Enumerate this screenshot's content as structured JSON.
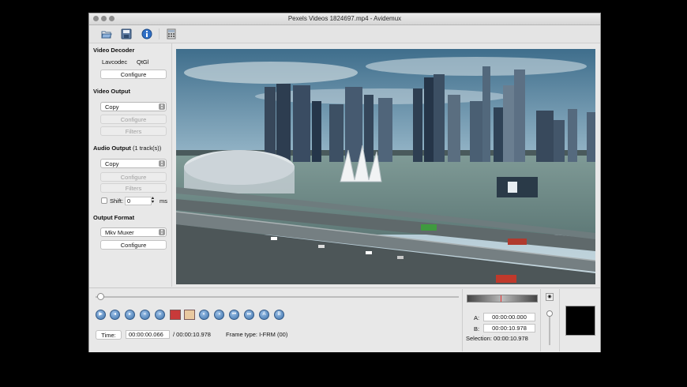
{
  "window": {
    "title": "Pexels Videos 1824697.mp4 - Avidemux"
  },
  "toolbar": {
    "icons": [
      "open-file-icon",
      "save-file-icon",
      "info-icon",
      "calculator-icon"
    ]
  },
  "video_decoder": {
    "heading": "Video Decoder",
    "codec_label": "Lavcodec",
    "codec_value": "QtGl",
    "configure_label": "Configure"
  },
  "video_output": {
    "heading": "Video Output",
    "selected": "Copy",
    "configure_label": "Configure",
    "filters_label": "Filters"
  },
  "audio_output": {
    "heading": "Audio Output",
    "tracks": "(1 track(s))",
    "selected": "Copy",
    "configure_label": "Configure",
    "filters_label": "Filters",
    "shift_label": "Shift:",
    "shift_value": "0",
    "shift_unit": "ms"
  },
  "output_format": {
    "heading": "Output Format",
    "selected": "Mkv Muxer",
    "configure_label": "Configure"
  },
  "playback": {
    "time_button": "Time:",
    "current_time": "00:00:00.066",
    "total_time": "/ 00:00:10.978",
    "frame_type": "Frame type:  I-FRM (00)",
    "position_fraction": 0.006
  },
  "selection": {
    "a_label": "A:",
    "a_value": "00:00:00.000",
    "b_label": "B:",
    "b_value": "00:00:10.978",
    "selection_text": "Selection: 00:00:10.978"
  },
  "colors": {
    "accent": "#3a6fa8",
    "window_bg": "#e8e8e8"
  }
}
